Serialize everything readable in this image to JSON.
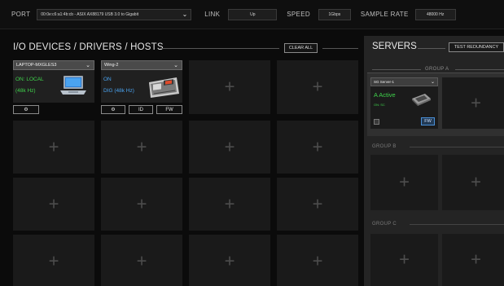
{
  "topbar": {
    "port_label": "PORT",
    "port_value": "00:0e:c6:a1:4b:cb - ASIX AX88179 USB 3.0 to Gigabit",
    "link_label": "LINK",
    "link_value": "Up",
    "speed_label": "SPEED",
    "speed_value": "1Gbps",
    "sample_rate_label": "SAMPLE RATE",
    "sample_rate_value": "48000 Hz"
  },
  "io": {
    "title": "I/O DEVICES / DRIVERS / HOSTS",
    "clear_all_label": "CLEAR ALL",
    "devices": [
      {
        "name": "LAPTOP-MXGLES3",
        "status": "ON: LOCAL",
        "rate": "(48k Hz)",
        "gear_label": "⚙"
      },
      {
        "name": "Wing-2",
        "status": "ON",
        "rate": "DIG (48k Hz)",
        "gear_label": "⚙",
        "id_label": "ID",
        "fw_label": "FW"
      }
    ],
    "empty_symbol": "+"
  },
  "servers": {
    "title": "SERVERS",
    "test_redundancy_label": "TEST REDUNDANCY",
    "group_a_label": "GROUP A",
    "group_b_label": "GROUP B",
    "group_c_label": "GROUP C",
    "server": {
      "name": "SG Server-1",
      "status": "A Active",
      "sub": "ON: SC",
      "fw_label": "FW"
    },
    "empty_symbol": "+"
  },
  "colors": {
    "status_green": "#3fd24b",
    "fw_blue": "#4a90d8",
    "background": "#0b0b0b"
  }
}
